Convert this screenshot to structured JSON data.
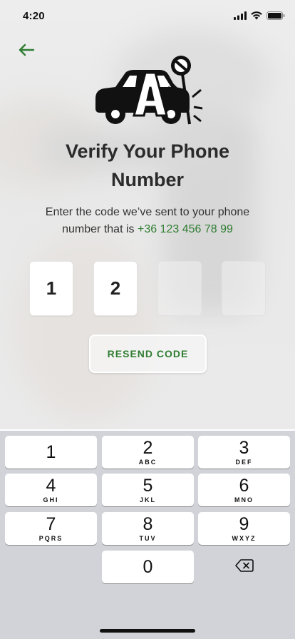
{
  "status_bar": {
    "time": "4:20"
  },
  "header": {
    "title_line1": "Verify Your Phone",
    "title_line2": "Number",
    "subtitle_line1": "Enter the code we’ve sent to your phone",
    "subtitle_line2_prefix": "number that is",
    "phone_number": "+36 123 456 78 99"
  },
  "code_inputs": [
    {
      "value": "1"
    },
    {
      "value": "2"
    },
    {
      "value": ""
    },
    {
      "value": ""
    }
  ],
  "resend_label": "RESEND CODE",
  "keypad": {
    "keys": [
      {
        "num": "1",
        "letters": ""
      },
      {
        "num": "2",
        "letters": "ABC"
      },
      {
        "num": "3",
        "letters": "DEF"
      },
      {
        "num": "4",
        "letters": "GHI"
      },
      {
        "num": "5",
        "letters": "JKL"
      },
      {
        "num": "6",
        "letters": "MNO"
      },
      {
        "num": "7",
        "letters": "PQRS"
      },
      {
        "num": "8",
        "letters": "TUV"
      },
      {
        "num": "9",
        "letters": "WXYZ"
      },
      {
        "num": "0",
        "letters": ""
      }
    ]
  },
  "icons": {
    "back": "arrow-left-icon",
    "delete": "backspace-icon",
    "logo": "car-logo-icon"
  },
  "colors": {
    "accent": "#2f7d32",
    "title": "#2b2b2b",
    "keypad_bg": "#d1d3d9"
  }
}
